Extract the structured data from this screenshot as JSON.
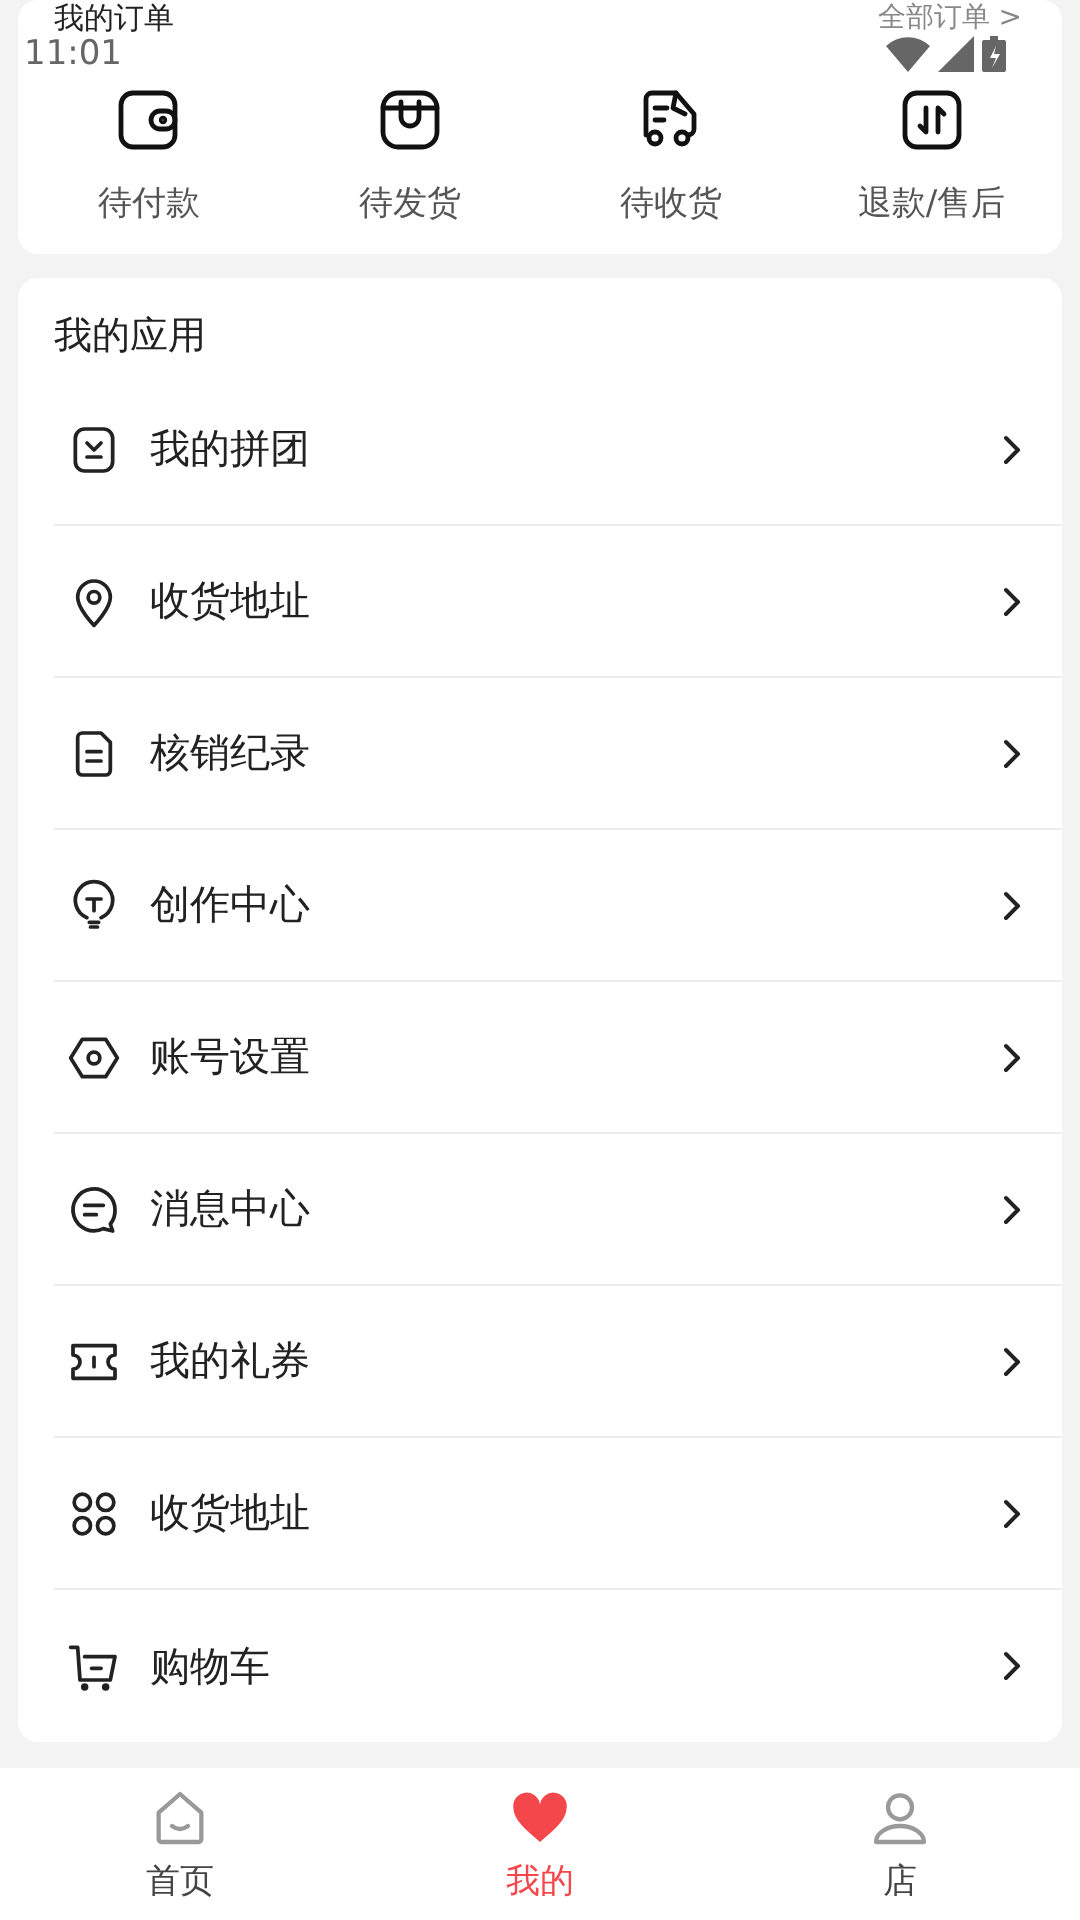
{
  "orders": {
    "title": "我的订单",
    "all_link": "全部订单 >",
    "items": [
      {
        "label": "待付款",
        "kind": "wallet"
      },
      {
        "label": "待发货",
        "kind": "bag"
      },
      {
        "label": "待收货",
        "kind": "truck"
      },
      {
        "label": "退款/售后",
        "kind": "refund"
      }
    ]
  },
  "status_bar": {
    "time": "11:01"
  },
  "apps": {
    "title": "我的应用",
    "items": [
      {
        "label": "我的拼团",
        "kind": "group"
      },
      {
        "label": "收货地址",
        "kind": "pin"
      },
      {
        "label": "核销纪录",
        "kind": "doc"
      },
      {
        "label": "创作中心",
        "kind": "bulb"
      },
      {
        "label": "账号设置",
        "kind": "hex"
      },
      {
        "label": "消息中心",
        "kind": "chat"
      },
      {
        "label": "我的礼券",
        "kind": "ticket"
      },
      {
        "label": "收货地址",
        "kind": "grid"
      },
      {
        "label": "购物车",
        "kind": "cart"
      }
    ]
  },
  "tabbar": [
    {
      "label": "首页",
      "kind": "home",
      "selected": false
    },
    {
      "label": "我的",
      "kind": "heart",
      "selected": true
    },
    {
      "label": "店",
      "kind": "person",
      "selected": false
    }
  ]
}
